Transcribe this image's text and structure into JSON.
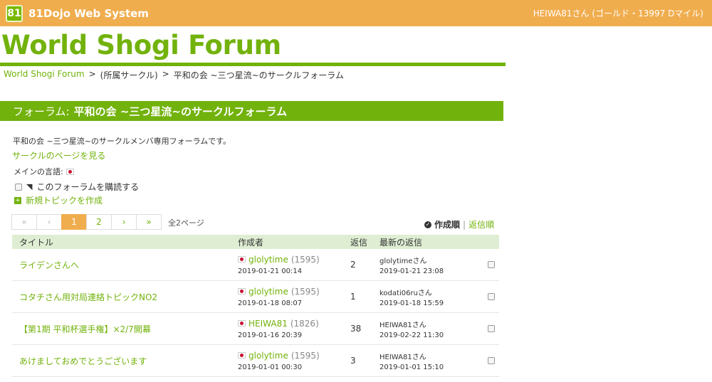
{
  "topbar": {
    "logo": "81",
    "app_name": "81Dojo Web System",
    "user": "HEIWA81さん",
    "rank_open": "(",
    "rank": "ゴールド",
    "miles": "・13997 Dマイル)"
  },
  "page": {
    "title": "World Shogi Forum"
  },
  "breadcrumb": {
    "root": "World Shogi Forum",
    "sep1": ">",
    "section": "(所属サークル)",
    "sep2": ">",
    "current": "平和の会 ~三つ星流~のサークルフォーラム"
  },
  "forum": {
    "label": "フォーラム:",
    "name": "平和の会 ~三つ星流~のサークルフォーラム",
    "description": "平和の会 ~三つ星流~のサークルメンバ専用フォーラムです。",
    "circle_link": "サークルのページを見る",
    "language_label": "メインの言語:",
    "subscribe_label": "このフォーラムを購読する",
    "new_topic_label": "新規トピックを作成"
  },
  "pagination": {
    "first": "«",
    "prev": "‹",
    "pages": [
      "1",
      "2"
    ],
    "next": "›",
    "last": "»",
    "total_pages": "全2ページ"
  },
  "sort": {
    "by_created": "作成順",
    "separator": "|",
    "by_reply": "返信順"
  },
  "table": {
    "headers": {
      "title": "タイトル",
      "author": "作成者",
      "replies": "返信",
      "latest": "最新の返信"
    },
    "rows": [
      {
        "title": "ライデンさんへ",
        "author": "glolytime",
        "rating": "(1595)",
        "created": "2019-01-21 00:14",
        "replies": "2",
        "latest_user": "glolytimeさん",
        "latest_date": "2019-01-21 23:08"
      },
      {
        "title": "コタチさん用対局連絡トピックNO2",
        "author": "glolytime",
        "rating": "(1595)",
        "created": "2019-01-18 08:07",
        "replies": "1",
        "latest_user": "kodati06ruさん",
        "latest_date": "2019-01-18 15:59"
      },
      {
        "title": "【第1期 平和杯選手権】×2/7開幕",
        "author": "HEIWA81",
        "rating": "(1826)",
        "created": "2019-01-16 20:39",
        "replies": "38",
        "latest_user": "HEIWA81さん",
        "latest_date": "2019-02-22 11:30"
      },
      {
        "title": "あけましておめでとうございます",
        "author": "glolytime",
        "rating": "(1595)",
        "created": "2019-01-01 00:30",
        "replies": "3",
        "latest_user": "HEIWA81さん",
        "latest_date": "2019-01-01 15:10"
      }
    ]
  },
  "colors": {
    "accent_green": "#72b20c",
    "topbar_orange": "#f0ad4e",
    "header_row": "#dfeed3"
  }
}
